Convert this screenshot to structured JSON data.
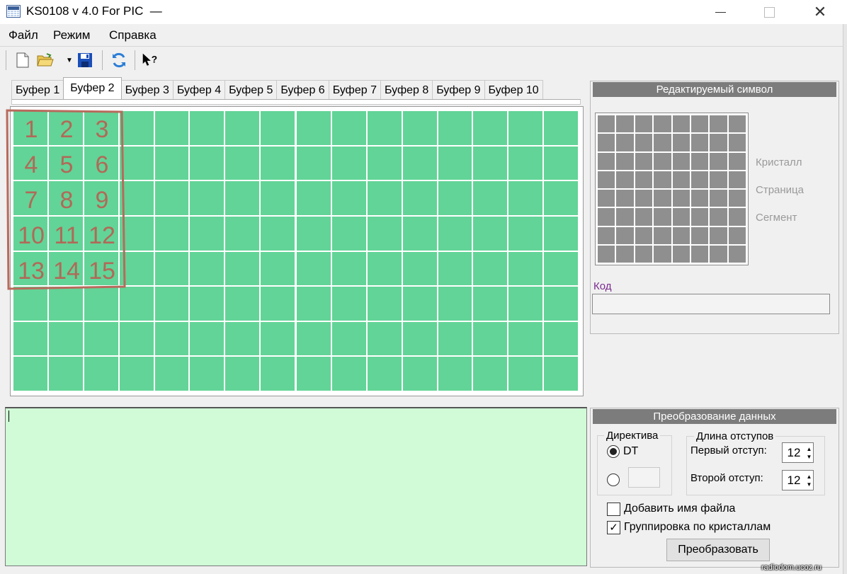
{
  "window": {
    "title": "KS0108 v 4.0 For PIC  —",
    "close_glyph": "✕"
  },
  "menu": [
    "Файл",
    "Режим",
    "Справка"
  ],
  "toolbar": {
    "dropdown_glyph": "▼",
    "icons": [
      "new-file-icon",
      "open-folder-icon",
      "dropdown-arrow-icon",
      "save-icon",
      "refresh-icon",
      "help-pointer-icon"
    ]
  },
  "tabs": [
    "Буфер 1",
    "Буфер 2",
    "Буфер 3",
    "Буфер 4",
    "Буфер 5",
    "Буфер 6",
    "Буфер 7",
    "Буфер 8",
    "Буфер 9",
    "Буфер 10"
  ],
  "active_tab": "Буфер 2",
  "lcd": {
    "cell_color": "#62d497",
    "grid_color": "#ffffff"
  },
  "annotation": {
    "color": "#b06a58",
    "numbers": [
      "1",
      "2",
      "3",
      "4",
      "5",
      "6",
      "7",
      "8",
      "9",
      "10",
      "11",
      "12",
      "13",
      "14",
      "15"
    ]
  },
  "output": {
    "background": "#d0fbd6"
  },
  "symbol_panel": {
    "title": "Редактируемый символ",
    "crystal_label": "Кристалл",
    "page_label": "Страница",
    "segment_label": "Сегмент",
    "code_label": "Код",
    "pixel_color": "#8f8f8f"
  },
  "conversion": {
    "title": "Преобразование данных",
    "directive_title": "Директива",
    "dt_label": "DT",
    "indent_title": "Длина отступов",
    "first_indent_label": "Первый отступ:",
    "first_indent_value": "12",
    "second_indent_label": "Второй отступ:",
    "second_indent_value": "12",
    "up_glyph": "▲",
    "down_glyph": "▼",
    "add_filename_label": "Добавить имя файла",
    "add_filename_checked": false,
    "group_label": "Группировка по кристаллам",
    "group_checked": true,
    "check_glyph": "✓",
    "convert_button": "Преобразовать"
  },
  "watermark": "radiodom.ucoz.ru"
}
